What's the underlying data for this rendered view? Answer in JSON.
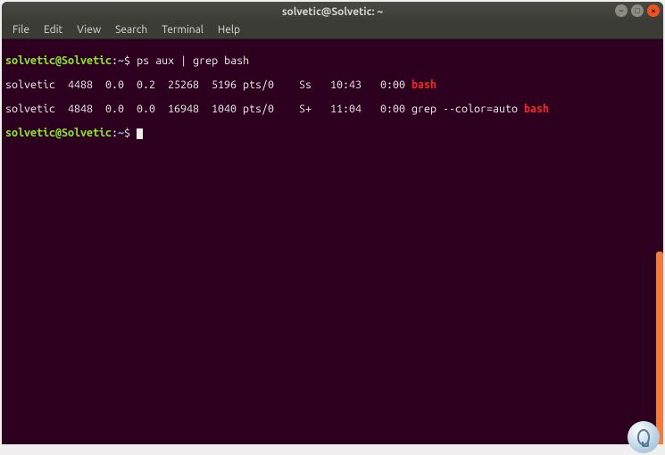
{
  "titlebar": {
    "title": "solvetic@Solvetic: ~"
  },
  "menubar": {
    "items": [
      {
        "label": "File"
      },
      {
        "label": "Edit"
      },
      {
        "label": "View"
      },
      {
        "label": "Search"
      },
      {
        "label": "Terminal"
      },
      {
        "label": "Help"
      }
    ]
  },
  "prompt": {
    "user_host": "solvetic@Solvetic",
    "colon": ":",
    "path": "~",
    "symbol": "$"
  },
  "commands": {
    "cmd1": " ps aux | grep bash"
  },
  "output": {
    "row1_pre": "solvetic  4488  0.0  0.2  25268  5196 pts/0    Ss   10:43   0:00 ",
    "row1_match": "bash",
    "row2_pre": "solvetic  4848  0.0  0.0  16948  1040 pts/0    S+   11:04   0:00 grep --color=auto ",
    "row2_match": "bash"
  }
}
